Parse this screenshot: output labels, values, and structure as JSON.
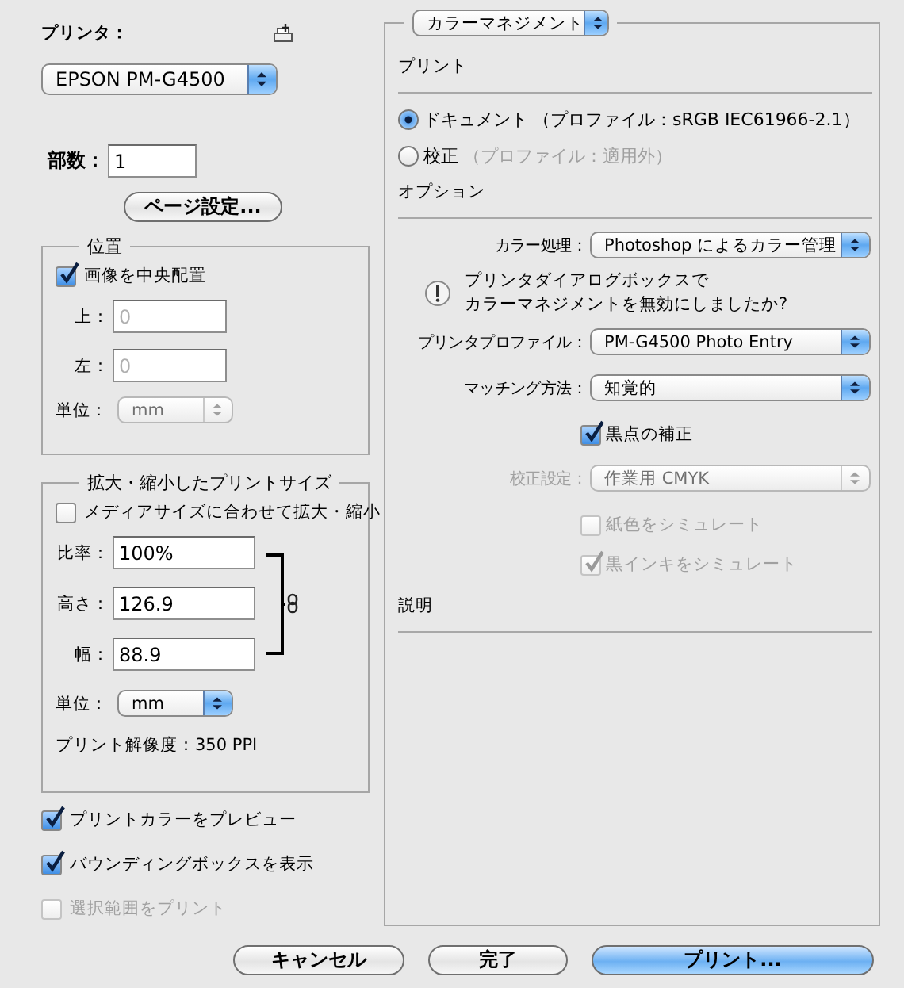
{
  "printer": {
    "label": "プリンタ：",
    "value": "EPSON PM-G4500"
  },
  "copies": {
    "label": "部数：",
    "value": "1"
  },
  "page_setup_button": "ページ設定...",
  "position": {
    "title": "位置",
    "center": {
      "label": "画像を中央配置",
      "checked": true,
      "disabled": false
    },
    "fields": [
      {
        "label": "上：",
        "value": "0",
        "disabled": true
      },
      {
        "label": "左：",
        "value": "0",
        "disabled": true
      }
    ],
    "unit": {
      "label": "単位：",
      "value": "mm",
      "disabled": true
    }
  },
  "scaled_size": {
    "title": "拡大・縮小したプリントサイズ",
    "fit": {
      "label": "メディアサイズに合わせて拡大・縮小",
      "checked": false,
      "disabled": false
    },
    "fields": [
      {
        "label": "比率：",
        "value": "100%",
        "disabled": false
      },
      {
        "label": "高さ：",
        "value": "126.9",
        "disabled": false
      },
      {
        "label": "幅：",
        "value": "88.9",
        "disabled": false
      }
    ],
    "unit": {
      "label": "単位：",
      "value": "mm",
      "disabled": false
    },
    "resolution": "プリント解像度：350 PPI"
  },
  "options": [
    {
      "label": "プリントカラーをプレビュー",
      "checked": true,
      "disabled": false
    },
    {
      "label": "バウンディングボックスを表示",
      "checked": true,
      "disabled": false
    },
    {
      "label": "選択範囲をプリント",
      "checked": false,
      "disabled": true
    }
  ],
  "color_management": {
    "mode": "カラーマネジメント",
    "print_heading": "プリント",
    "radios": [
      {
        "label": "ドキュメント",
        "note": "（プロファイル：sRGB IEC61966-2.1）",
        "selected": true
      },
      {
        "label": "校正",
        "note": "（プロファイル：適用外）",
        "selected": false
      }
    ],
    "options_heading": "オプション",
    "rows": [
      {
        "kind": "popup",
        "label": "カラー処理：",
        "value": "Photoshop によるカラー管理",
        "disabled": false
      },
      {
        "kind": "warning",
        "lines": [
          "プリンタダイアログボックスで",
          "カラーマネジメントを無効にしましたか?"
        ]
      },
      {
        "kind": "popup",
        "label": "プリンタプロファイル：",
        "value": "PM-G4500 Photo Entry",
        "disabled": false
      },
      {
        "kind": "popup",
        "label": "マッチング方法：",
        "value": "知覚的",
        "disabled": false
      },
      {
        "kind": "checkbox",
        "label": "黒点の補正",
        "checked": true,
        "disabled": false
      },
      {
        "kind": "popup",
        "label": "校正設定：",
        "value": "作業用 CMYK",
        "disabled": true
      },
      {
        "kind": "checkbox",
        "label": "紙色をシミュレート",
        "checked": false,
        "disabled": true
      },
      {
        "kind": "checkbox",
        "label": "黒インキをシミュレート",
        "checked": true,
        "disabled": true
      }
    ],
    "description_heading": "説明"
  },
  "buttons": [
    {
      "label": "キャンセル",
      "default": false
    },
    {
      "label": "完了",
      "default": false
    },
    {
      "label": "プリント...",
      "default": true
    }
  ]
}
